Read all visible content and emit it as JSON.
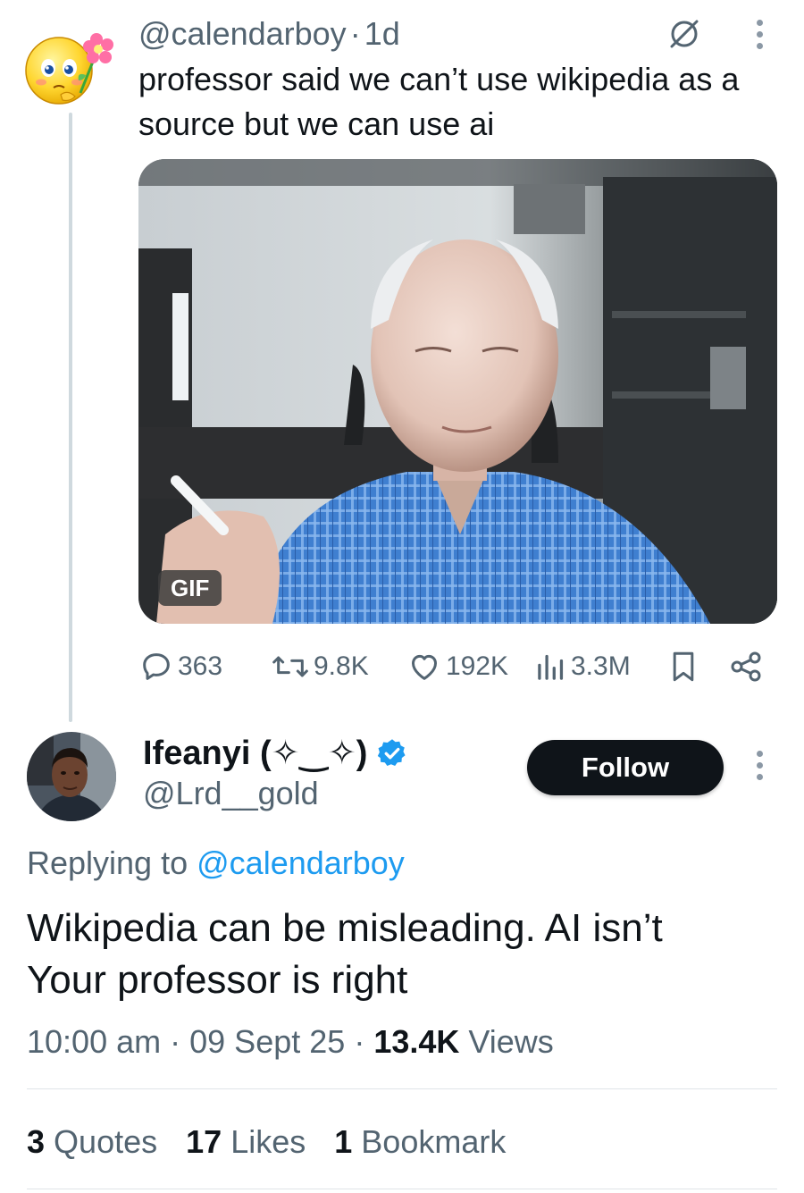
{
  "parent_tweet": {
    "handle": "@calendarboy",
    "separator": "·",
    "age": "1d",
    "text": "professor said we can’t use wikipedia as a source but we can use ai",
    "avatar_icon": "shy-smiley-flower-emoji",
    "media": {
      "badge": "GIF"
    },
    "actions": {
      "replies": "363",
      "reposts": "9.8K",
      "likes": "192K",
      "views": "3.3M"
    }
  },
  "reply_tweet": {
    "display_name": "Ifeanyi (✧‿✧)",
    "verified": true,
    "handle": "@Lrd__gold",
    "follow_label": "Follow",
    "replying_prefix": "Replying to",
    "replying_mention": "@calendarboy",
    "text_line1": "Wikipedia can be misleading. AI isn’t",
    "text_line2": "Your professor is right",
    "time": "10:00 am",
    "separator": "·",
    "date": "09 Sept 25",
    "views_count": "13.4K",
    "views_label": "Views",
    "stats": {
      "quotes_count": "3",
      "quotes_label": "Quotes",
      "likes_count": "17",
      "likes_label": "Likes",
      "bookmarks_count": "1",
      "bookmarks_label": "Bookmark"
    }
  },
  "colors": {
    "text": "#0f1419",
    "muted": "#536471",
    "accent": "#1d9bf0",
    "button_bg": "#0f1419"
  }
}
